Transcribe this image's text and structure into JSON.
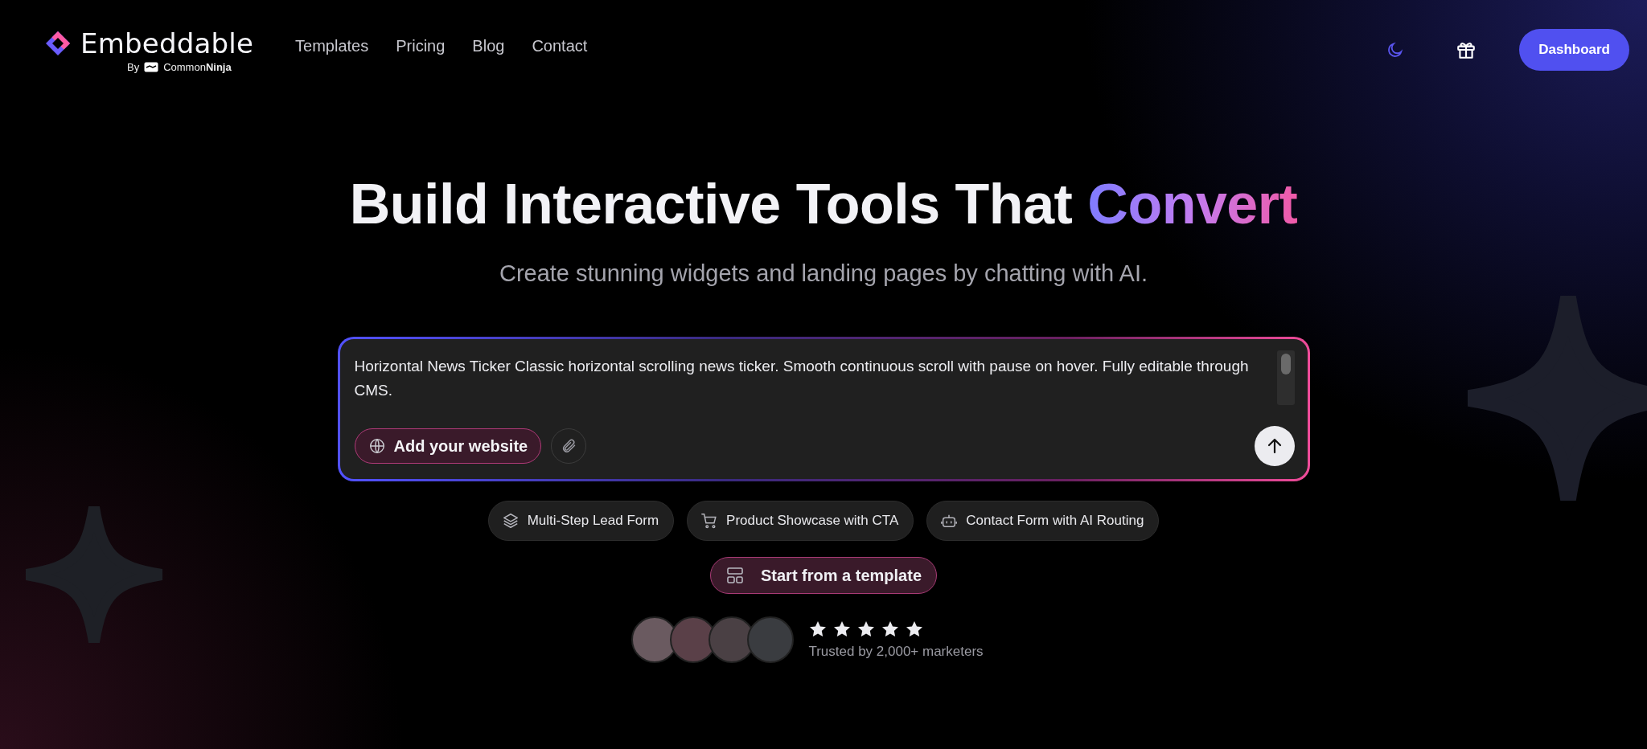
{
  "header": {
    "brand": "Embeddable",
    "byline": "By",
    "partner": "Common**Ninja**",
    "nav": [
      "Templates",
      "Pricing",
      "Blog",
      "Contact"
    ],
    "dashboard_button": "Dashboard"
  },
  "hero": {
    "headline": "Build Interactive Tools That",
    "highlight": "Convert",
    "subtitle": "Create stunning widgets and landing pages by chatting with AI."
  },
  "prompt": {
    "value": "Horizontal News Ticker Classic horizontal scrolling news ticker. Smooth continuous scroll with pause on hover. Fully editable through CMS.",
    "website_button": "Add your website"
  },
  "suggestions": [
    "Multi-Step Lead Form",
    "Product Showcase with CTA",
    "Contact Form with AI Routing"
  ],
  "template_button": "Start from a template",
  "social_proof": {
    "stars": 5,
    "caption": "Trusted by 2,000+ marketers"
  }
}
